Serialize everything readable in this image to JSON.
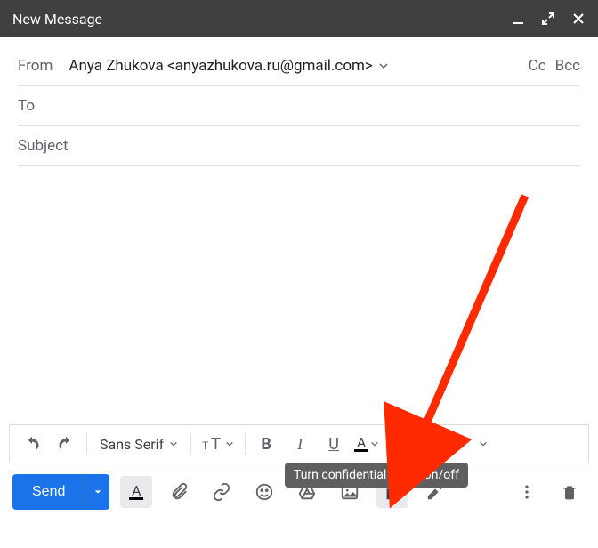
{
  "header": {
    "title": "New Message"
  },
  "fields": {
    "from_label": "From",
    "from_value": "Anya Zhukova <anyazhukova.ru@gmail.com>",
    "cc_label": "Cc",
    "bcc_label": "Bcc",
    "to_label": "To",
    "subject_placeholder": "Subject"
  },
  "format": {
    "font_family": "Sans Serif",
    "bold": "B",
    "italic": "I",
    "underline": "U"
  },
  "actions": {
    "send_label": "Send"
  },
  "tooltip": {
    "confidential": "Turn confidential mode on/off"
  },
  "textcolor_glyph": "A"
}
